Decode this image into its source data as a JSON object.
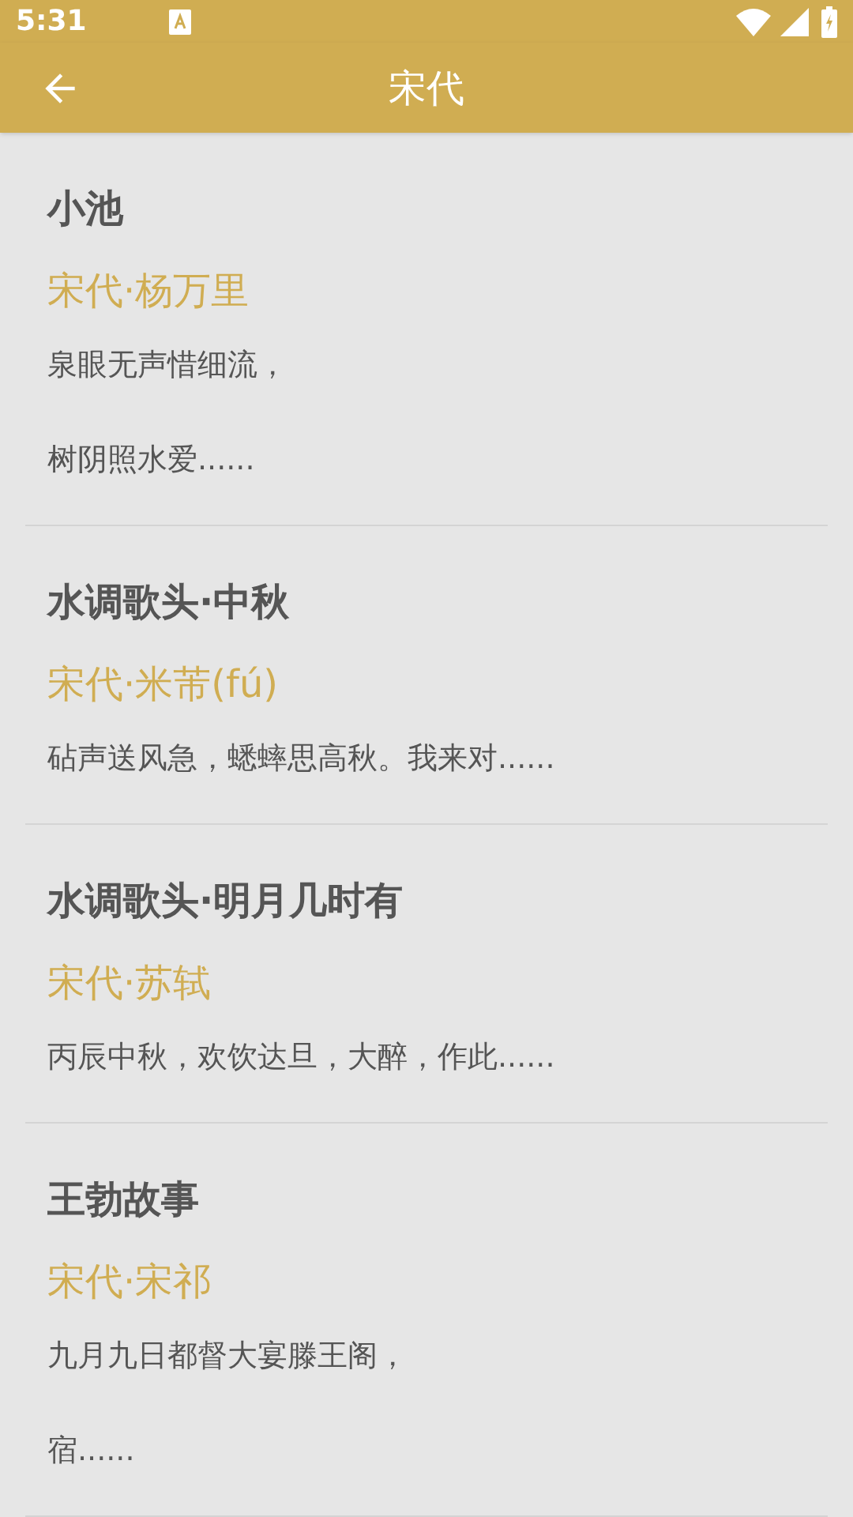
{
  "status_bar": {
    "time": "5:31"
  },
  "app_bar": {
    "title": "宋代"
  },
  "poems": [
    {
      "title": "小池",
      "author": "宋代·杨万里",
      "lines": [
        "泉眼无声惜细流，",
        "树阴照水爱......"
      ]
    },
    {
      "title": "水调歌头·中秋",
      "author": "宋代·米芾(fú)",
      "lines": [
        "砧声送风急，蟋蟀思高秋。我来对......"
      ]
    },
    {
      "title": "水调歌头·明月几时有",
      "author": "宋代·苏轼",
      "lines": [
        "丙辰中秋，欢饮达旦，大醉，作此......"
      ]
    },
    {
      "title": "王勃故事",
      "author": "宋代·宋祁",
      "lines": [
        "九月九日都督大宴滕王阁，",
        "宿......"
      ]
    }
  ]
}
